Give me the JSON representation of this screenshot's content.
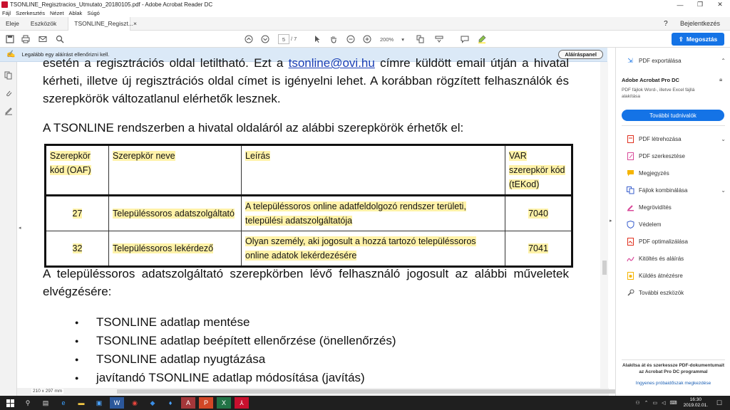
{
  "window": {
    "title": "TSONLINE_Regisztracios_Utmutato_20180105.pdf - Adobe Acrobat Reader DC",
    "minimize": "—",
    "maximize": "❐",
    "close": "✕"
  },
  "menu": [
    "Fájl",
    "Szerkesztés",
    "Nézet",
    "Ablak",
    "Súgó"
  ],
  "tabs": {
    "home": "Eleje",
    "tools": "Eszközök",
    "doc": "TSONLINE_Regiszt...",
    "doc_close": "×",
    "help": "?",
    "signin": "Bejelentkezés"
  },
  "toolbar": {
    "page_current": "5",
    "page_total": "/ 7",
    "zoom": "200%",
    "share": "Megosztás"
  },
  "signature_bar": {
    "message": "Legalább egy aláírást ellenőrizni kell.",
    "button": "Aláíráspanel"
  },
  "document": {
    "para_cut_1a": "esetén a regisztrációs oldal letiltható. Ezt a",
    "para_cut_link": "tsonline@ovi.hu",
    "para_cut_1b": "címre küldött email útján a hivatal kérheti, illetve új regisztrációs oldal címet is igényelni lehet. A korábban rögzített felhasználók és szerepkörök változatlanul elérhetők lesznek.",
    "para_intro": "A TSONLINE rendszerben a hivatal oldaláról az alábbi szerepkörök érhetők el:",
    "table": {
      "headers": [
        "Szerepkör kód (OAF)",
        "Szerepkör neve",
        "Leírás",
        "VAR szerepkör kód (tEKod)"
      ],
      "rows": [
        [
          "27",
          "Településsoros adatszolgáltató",
          "A településsoros online adatfeldolgozó rendszer területi, települési adatszolgáltatója",
          "7040"
        ],
        [
          "32",
          "Településsoros lekérdező",
          "Olyan személy, aki jogosult a hozzá tartozó településsoros online adatok lekérdezésére",
          "7041"
        ]
      ]
    },
    "para_rights": "A településsoros adatszolgáltató szerepkörben lévő felhasználó jogosult az alábbi műveletek elvégzésére:",
    "bullets": [
      "TSONLINE adatlap mentése",
      "TSONLINE adatlap beépített ellenőrzése (önellenőrzés)",
      "TSONLINE adatlap nyugtázása",
      "javítandó TSONLINE adatlap módosítása (javítás)"
    ],
    "page_size": "210 x 297 mm"
  },
  "right_panel": {
    "export": "PDF exportálása",
    "pro_title": "Adobe Acrobat Pro DC",
    "pro_desc": "PDF fájlok Word-, illetve Excel fájllá alakítása",
    "more_info": "További tudnivalók",
    "tools": [
      {
        "label": "PDF létrehozása",
        "icon": "create-pdf-icon",
        "color": "#e0301e",
        "chev": true
      },
      {
        "label": "PDF szerkesztése",
        "icon": "edit-pdf-icon",
        "color": "#d9499a",
        "chev": false
      },
      {
        "label": "Megjegyzés",
        "icon": "comment-icon",
        "color": "#f5b400",
        "chev": false
      },
      {
        "label": "Fájlok kombinálása",
        "icon": "combine-files-icon",
        "color": "#3a5fcd",
        "chev": true
      },
      {
        "label": "Megrövidítés",
        "icon": "redact-icon",
        "color": "#d9499a",
        "chev": false
      },
      {
        "label": "Védelem",
        "icon": "protect-icon",
        "color": "#3a5fcd",
        "chev": false
      },
      {
        "label": "PDF optimalizálása",
        "icon": "optimize-pdf-icon",
        "color": "#e0301e",
        "chev": false
      },
      {
        "label": "Kitöltés és aláírás",
        "icon": "fill-sign-icon",
        "color": "#d9499a",
        "chev": false
      },
      {
        "label": "Küldés átnézésre",
        "icon": "send-review-icon",
        "color": "#f5b400",
        "chev": false
      },
      {
        "label": "További eszközök",
        "icon": "more-tools-icon",
        "color": "#555555",
        "chev": false
      }
    ],
    "promo": "Alakítsa át és szerkessze PDF-dokumentumait az Acrobat Pro DC programmal",
    "trial": "Ingyenes próbaidőszak megkezdése"
  },
  "taskbar": {
    "time": "16:30",
    "date": "2019.02.01."
  },
  "colors": {
    "accent": "#1473e6",
    "highlight": "#fff2a8",
    "sig_bar": "#dbe9f7"
  }
}
